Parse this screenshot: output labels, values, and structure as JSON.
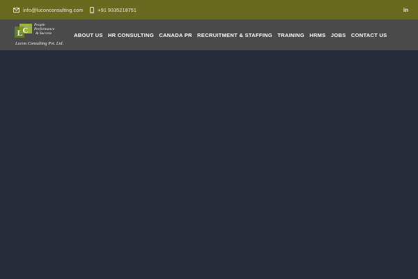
{
  "topbar": {
    "email": "info@luconconsulting.com",
    "phone": "+91 9335218751",
    "social": "in",
    "icons": {
      "email": "envelope-icon",
      "phone": "mobile-phone-icon",
      "social": "linkedin-icon"
    }
  },
  "logo": {
    "tagline": [
      "People",
      "Performance",
      "& Success"
    ],
    "company": "Lucon Consulting Pvt. Ltd."
  },
  "nav": {
    "items": [
      {
        "label": "ABOUT US"
      },
      {
        "label": "HR CONSULTING"
      },
      {
        "label": "CANADA PR"
      },
      {
        "label": "RECRUITMENT & STAFFING"
      },
      {
        "label": "TRAINING"
      },
      {
        "label": "HRMS"
      },
      {
        "label": "JOBS"
      },
      {
        "label": "CONTACT US"
      }
    ]
  },
  "colors": {
    "topbar": "#676b1f",
    "navbar": "#4a4a4a",
    "hero": "#252e38",
    "logo_green": "#9cb43a",
    "logo_dark_green": "#5f7d24"
  }
}
